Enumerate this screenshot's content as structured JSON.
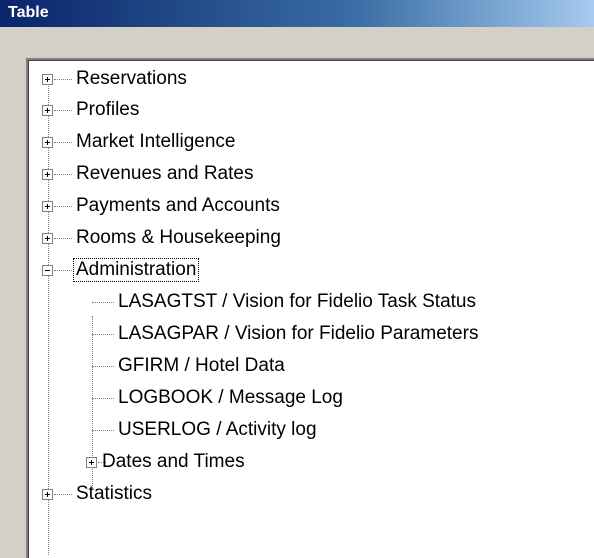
{
  "window": {
    "title": "Table"
  },
  "tree": {
    "items": [
      {
        "label": "Reservations",
        "state": "collapsed"
      },
      {
        "label": "Profiles",
        "state": "collapsed"
      },
      {
        "label": "Market Intelligence",
        "state": "collapsed"
      },
      {
        "label": "Revenues and Rates",
        "state": "collapsed"
      },
      {
        "label": "Payments and Accounts",
        "state": "collapsed"
      },
      {
        "label": "Rooms & Housekeeping",
        "state": "collapsed"
      },
      {
        "label": "Administration",
        "state": "expanded",
        "selected": true,
        "children": [
          {
            "label": "LASAGTST  /  Vision for Fidelio Task Status"
          },
          {
            "label": "LASAGPAR  /  Vision for Fidelio Parameters"
          },
          {
            "label": "GFIRM  /  Hotel Data"
          },
          {
            "label": "LOGBOOK  /  Message Log"
          },
          {
            "label": "USERLOG  /  Activity log"
          },
          {
            "label": "Dates and Times",
            "state": "collapsed"
          }
        ]
      },
      {
        "label": "Statistics",
        "state": "collapsed"
      }
    ]
  }
}
